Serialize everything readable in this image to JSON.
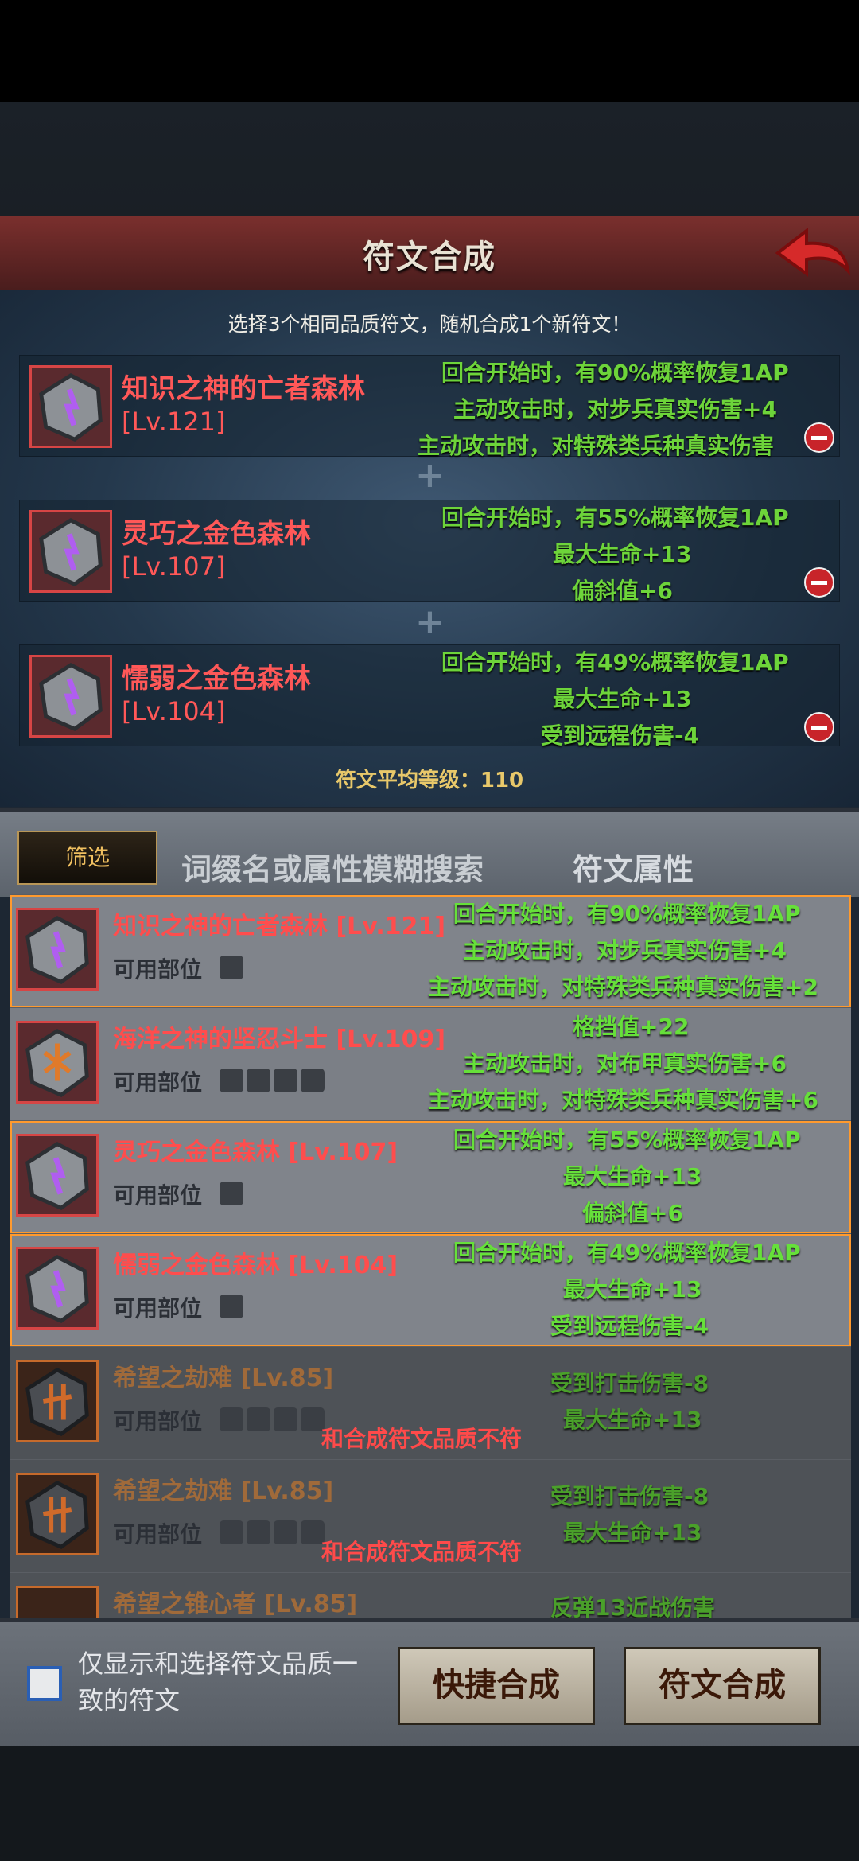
{
  "header": {
    "title": "符文合成",
    "back_icon": "back-arrow-icon"
  },
  "instruction": "选择3个相同品质符文，随机合成1个新符文！",
  "selected": [
    {
      "name": "知识之神的亡者森林",
      "level": "[Lv.121]",
      "attrs": [
        "回合开始时，有90%概率恢复1AP",
        "主动攻击时，对步兵真实伤害+4",
        "主动攻击时，对特殊类兵种真实伤害"
      ]
    },
    {
      "name": "灵巧之金色森林",
      "level": "[Lv.107]",
      "attrs": [
        "回合开始时，有55%概率恢复1AP",
        "最大生命+13",
        "偏斜值+6"
      ]
    },
    {
      "name": "懦弱之金色森林",
      "level": "[Lv.104]",
      "attrs": [
        "回合开始时，有49%概率恢复1AP",
        "最大生命+13",
        "受到远程伤害-4"
      ]
    }
  ],
  "plus_sign": "+",
  "average": "符文平均等级：110",
  "filter": {
    "button": "筛选",
    "search_placeholder": "词缀名或属性模糊搜索",
    "attr_select": "符文属性"
  },
  "slots_label": "可用部位",
  "mismatch_text": "和合成符文品质不符",
  "list": [
    {
      "name": "知识之神的亡者森林 [Lv.121]",
      "attrs": [
        "回合开始时，有90%概率恢复1AP",
        "主动攻击时，对步兵真实伤害+4",
        "主动攻击时，对特殊类兵种真实伤害+2"
      ]
    },
    {
      "name": "海洋之神的坚忍斗士 [Lv.109]",
      "attrs": [
        "格挡值+22",
        "主动攻击时，对布甲真实伤害+6",
        "主动攻击时，对特殊类兵种真实伤害+6"
      ]
    },
    {
      "name": "灵巧之金色森林 [Lv.107]",
      "attrs": [
        "回合开始时，有55%概率恢复1AP",
        "最大生命+13",
        "偏斜值+6"
      ]
    },
    {
      "name": "懦弱之金色森林 [Lv.104]",
      "attrs": [
        "回合开始时，有49%概率恢复1AP",
        "最大生命+13",
        "受到远程伤害-4"
      ]
    },
    {
      "name": "希望之劫难 [Lv.85]",
      "attrs": [
        "受到打击伤害-8",
        "最大生命+13"
      ]
    },
    {
      "name": "希望之劫难 [Lv.85]",
      "attrs": [
        "受到打击伤害-8",
        "最大生命+13"
      ]
    },
    {
      "name": "希望之锥心者 [Lv.85]",
      "attrs": [
        "反弹13近战伤害"
      ]
    }
  ],
  "bottom": {
    "checkbox_label": "仅显示和选择符文品质一致的符文",
    "quick_button": "快捷合成",
    "compose_button": "符文合成"
  }
}
